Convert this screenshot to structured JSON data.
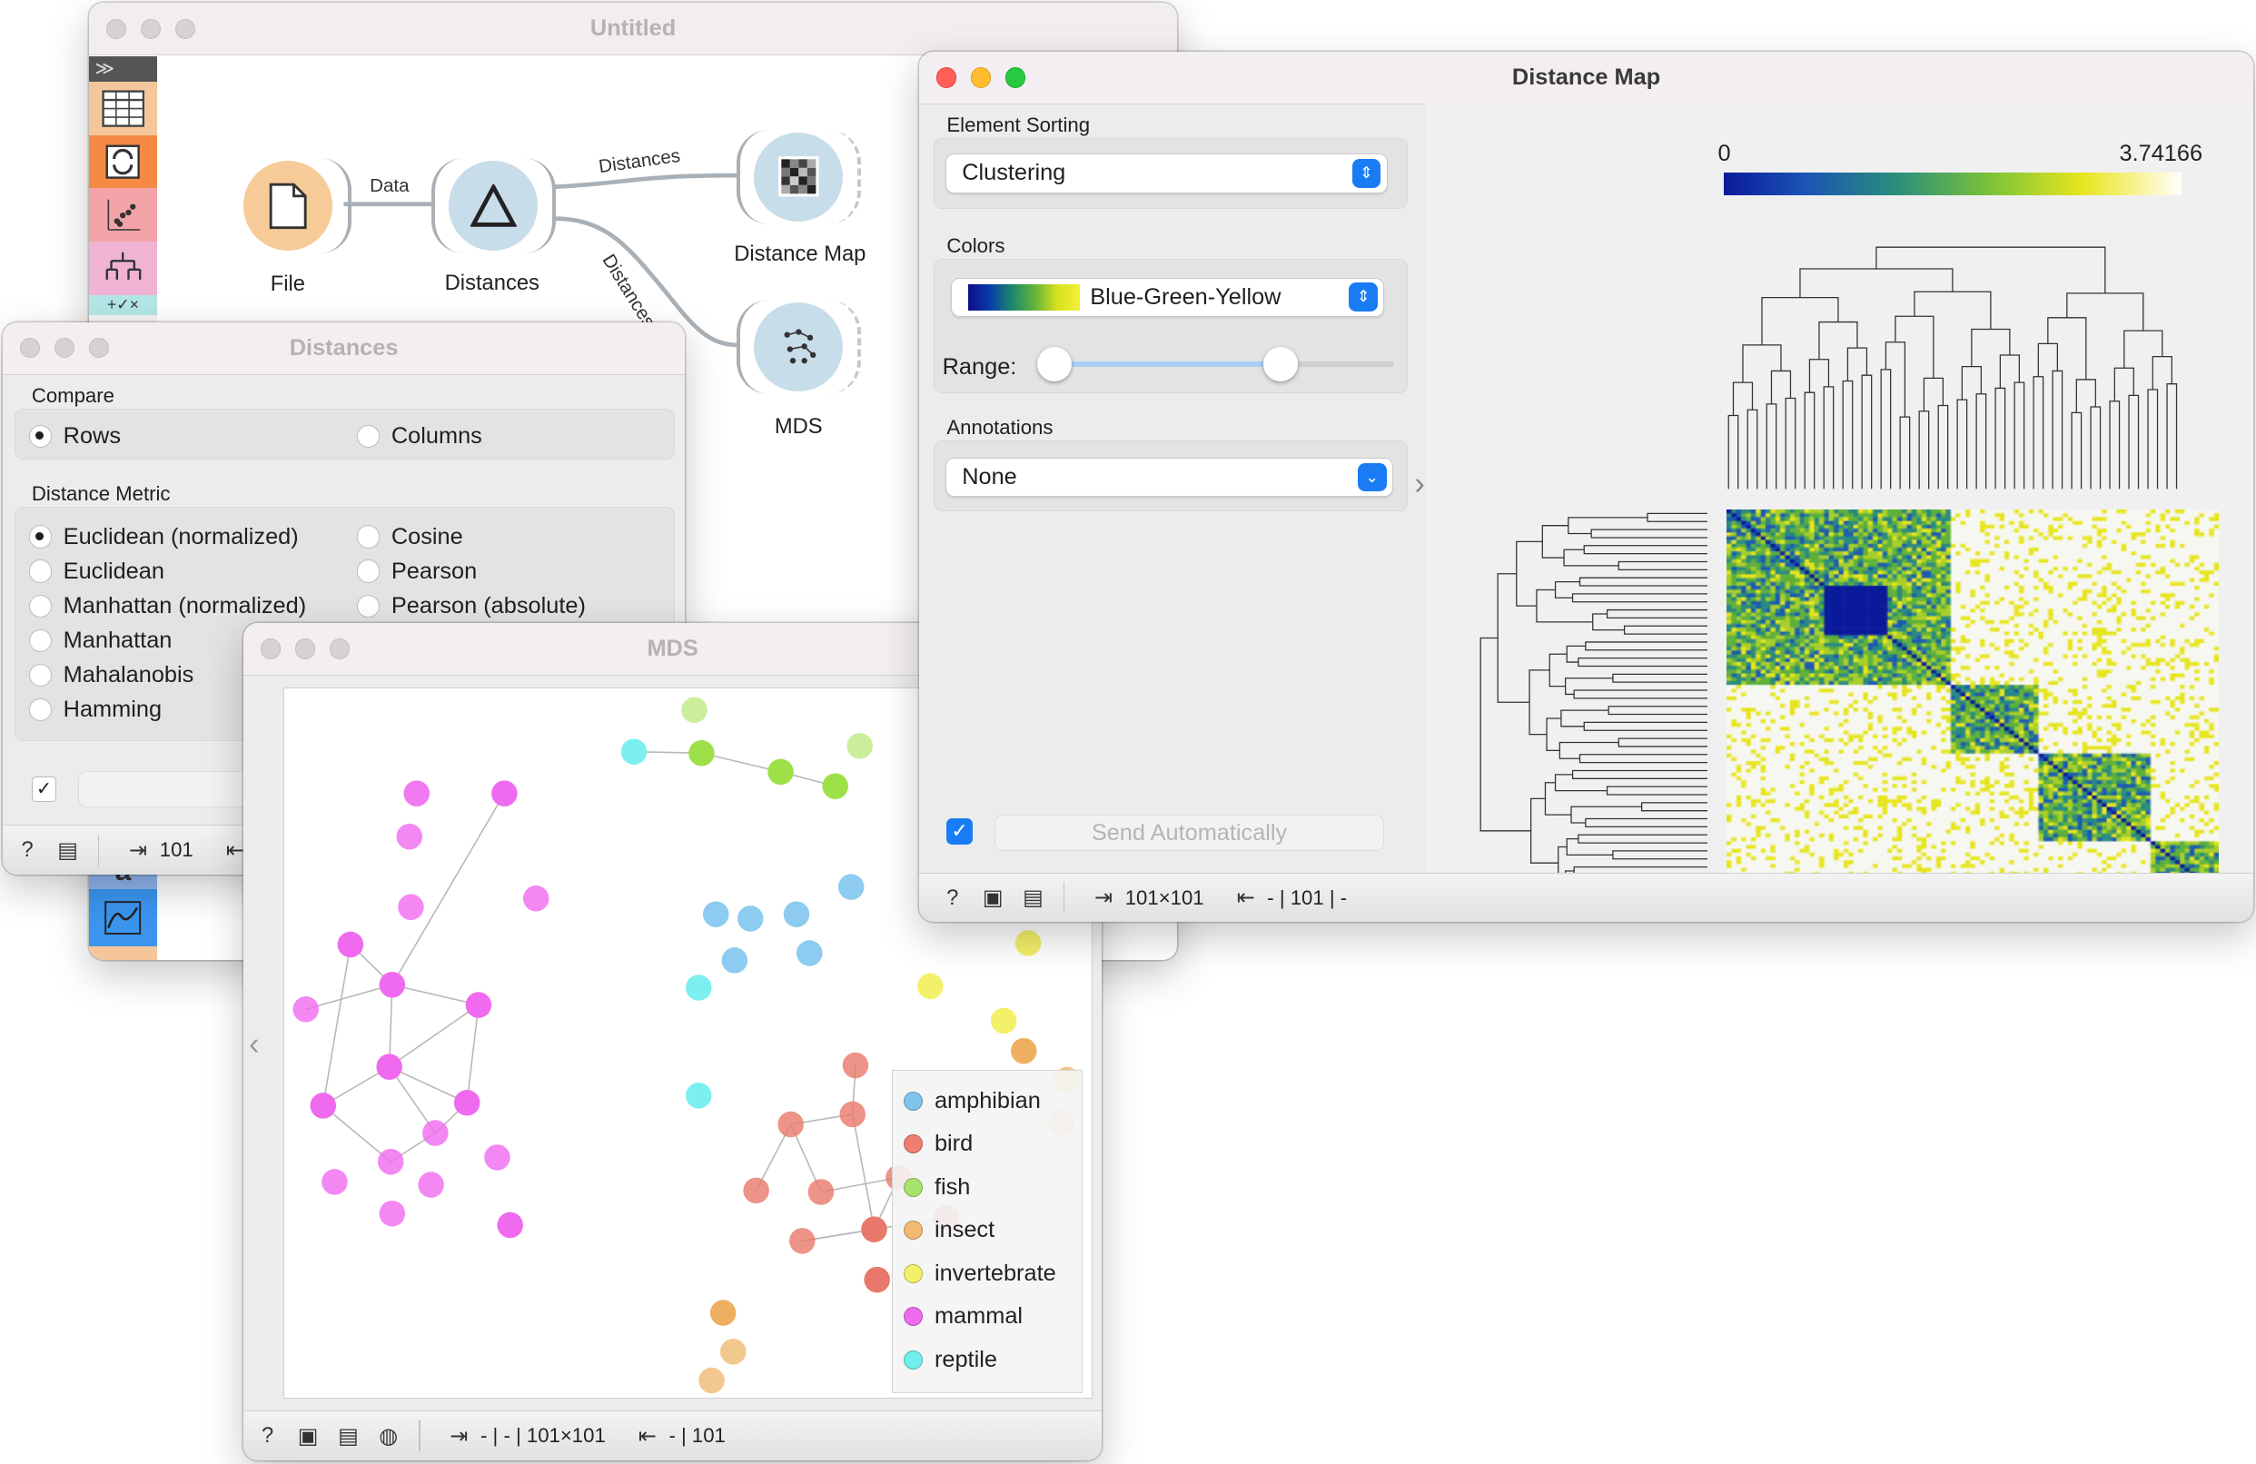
{
  "untitled": {
    "title": "Untitled",
    "sidebar_collapse": "≫",
    "nodes": [
      {
        "label": "File"
      },
      {
        "label": "Distances"
      },
      {
        "label": "Distance Map"
      },
      {
        "label": "MDS"
      }
    ],
    "links": [
      {
        "label": "Data"
      },
      {
        "label": "Distances"
      },
      {
        "label": "Distances"
      }
    ]
  },
  "distances": {
    "title": "Distances",
    "compare_label": "Compare",
    "compare_options": [
      "Rows",
      "Columns"
    ],
    "compare_selected": "Rows",
    "metric_label": "Distance Metric",
    "metric_options_left": [
      "Euclidean (normalized)",
      "Euclidean",
      "Manhattan (normalized)",
      "Manhattan",
      "Mahalanobis",
      "Hamming"
    ],
    "metric_options_right": [
      "Cosine",
      "Pearson",
      "Pearson (absolute)"
    ],
    "metric_selected": "Euclidean (normalized)",
    "status_in": "101"
  },
  "distance_map": {
    "title": "Distance Map",
    "sorting_label": "Element Sorting",
    "sorting_value": "Clustering",
    "colors_label": "Colors",
    "colors_value": "Blue-Green-Yellow",
    "range_label": "Range:",
    "annotations_label": "Annotations",
    "annotations_value": "None",
    "send_label": "Send Automatically",
    "scale_min": "0",
    "scale_max": "3.74166",
    "status_in": "101×101",
    "status_out": "- | 101 | -"
  },
  "mds": {
    "title": "MDS",
    "status_in": "- | - | 101×101",
    "status_out": "- | 101",
    "legend": [
      {
        "label": "amphibian",
        "color": "#7fc4ea"
      },
      {
        "label": "bird",
        "color": "#ee7f70"
      },
      {
        "label": "fish",
        "color": "#a6e36b"
      },
      {
        "label": "insect",
        "color": "#f3b873"
      },
      {
        "label": "invertebrate",
        "color": "#f3f06a"
      },
      {
        "label": "mammal",
        "color": "#f06af0"
      },
      {
        "label": "reptile",
        "color": "#6fefee"
      }
    ]
  },
  "colors": {
    "accent": "#1a7cf4",
    "mammal": "#f06af0",
    "fish": "#9ee048",
    "amphibian": "#8dcbf0",
    "reptile": "#7cf0f0",
    "bird": "#e8786a",
    "insect": "#eeb060",
    "invertebrate": "#f3f06a"
  }
}
